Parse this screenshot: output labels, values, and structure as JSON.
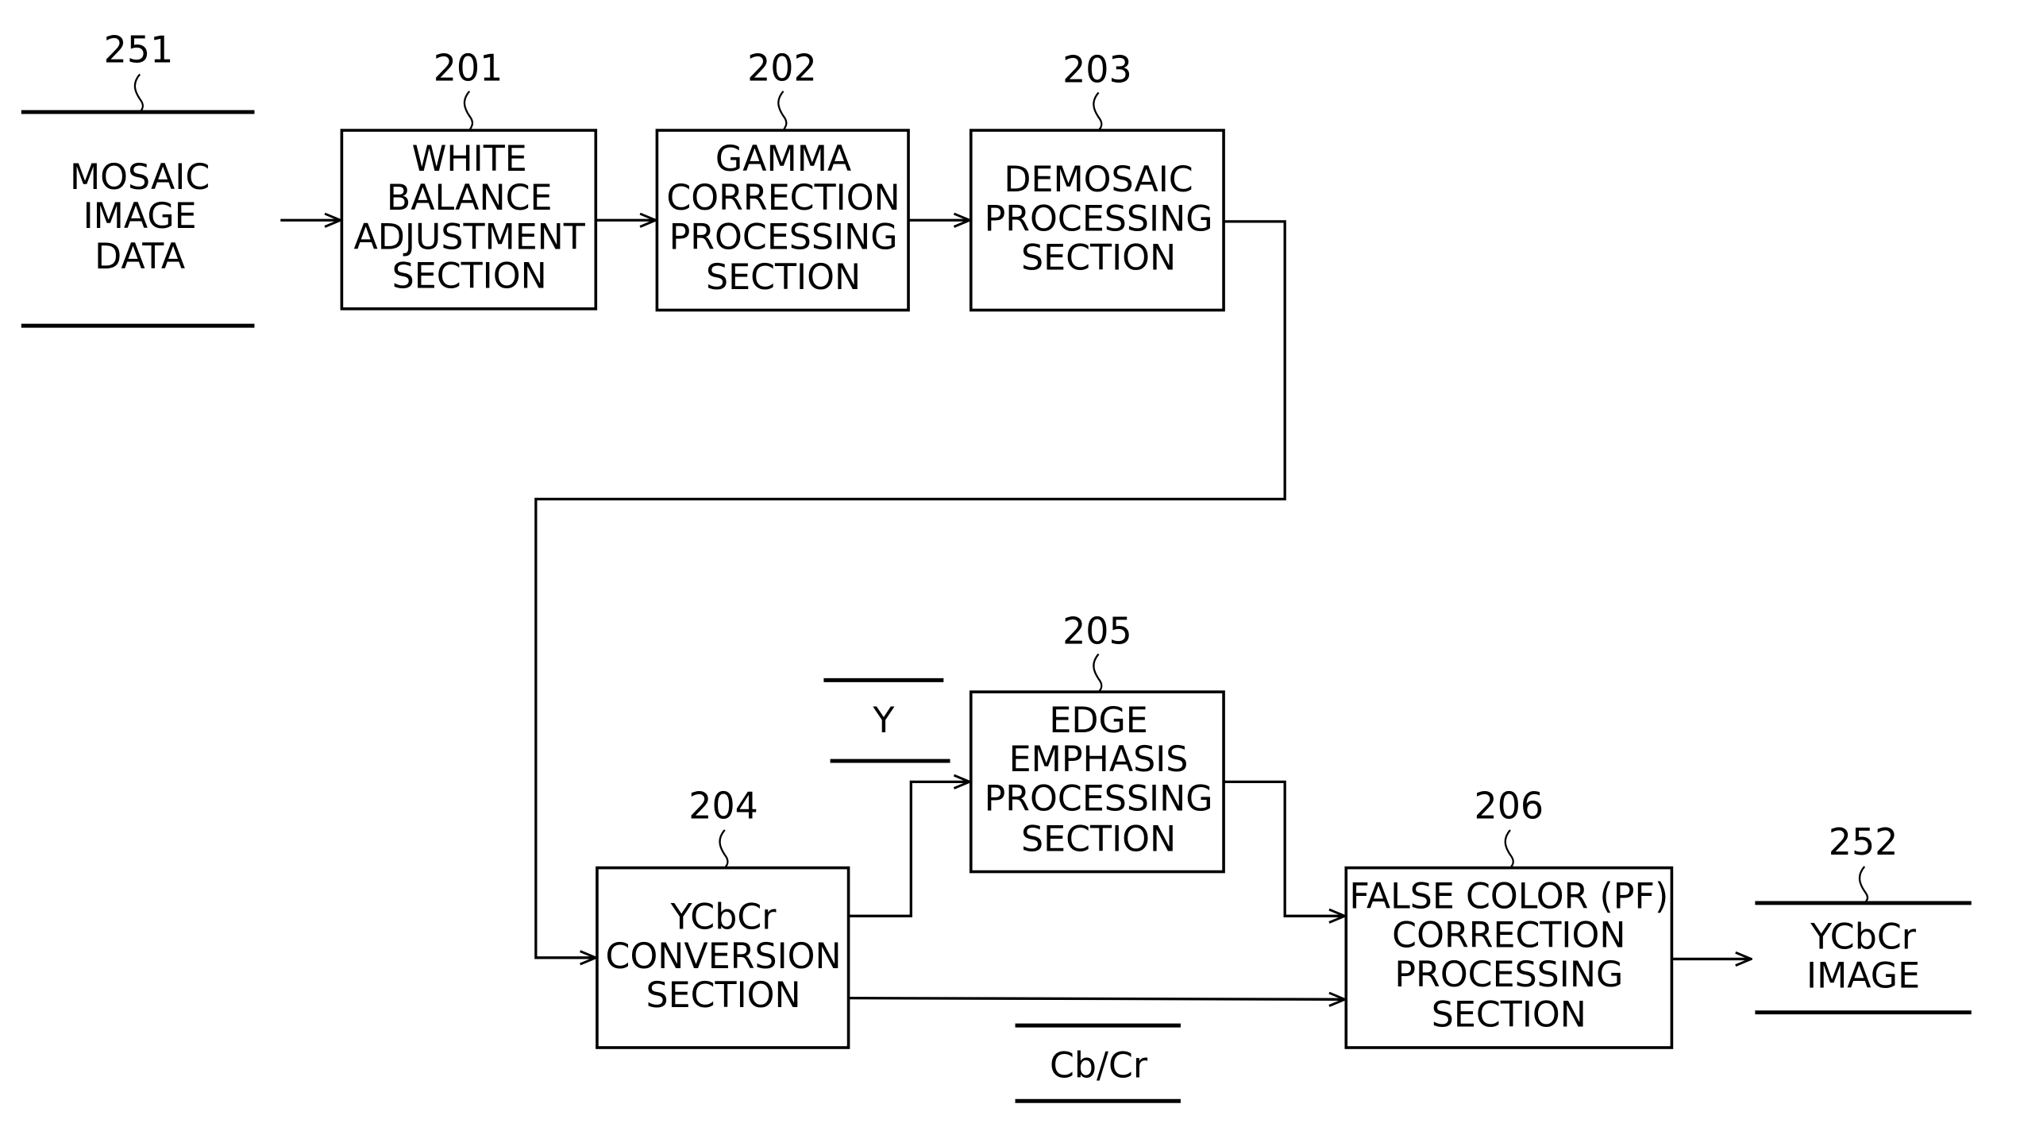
{
  "diagram": {
    "blocks": [
      {
        "id": "201",
        "ref": "201",
        "lines": [
          "WHITE",
          "BALANCE",
          "ADJUSTMENT",
          "SECTION"
        ]
      },
      {
        "id": "202",
        "ref": "202",
        "lines": [
          "GAMMA",
          "CORRECTION",
          "PROCESSING",
          "SECTION"
        ]
      },
      {
        "id": "203",
        "ref": "203",
        "lines": [
          "DEMOSAIC",
          "PROCESSING",
          "SECTION"
        ]
      },
      {
        "id": "204",
        "ref": "204",
        "lines": [
          "YCbCr",
          "CONVERSION",
          "SECTION"
        ]
      },
      {
        "id": "205",
        "ref": "205",
        "lines": [
          "EDGE",
          "EMPHASIS",
          "PROCESSING",
          "SECTION"
        ]
      },
      {
        "id": "206",
        "ref": "206",
        "lines": [
          "FALSE COLOR (PF)",
          "CORRECTION",
          "PROCESSING",
          "SECTION"
        ]
      }
    ],
    "data_stores": [
      {
        "id": "251",
        "ref": "251",
        "lines": [
          "MOSAIC",
          "IMAGE",
          "DATA"
        ]
      },
      {
        "id": "252",
        "ref": "252",
        "lines": [
          "YCbCr",
          "IMAGE"
        ]
      }
    ],
    "signals": {
      "y": "Y",
      "cbcr": "Cb/Cr"
    },
    "connections": [
      {
        "from": "251",
        "to": "201"
      },
      {
        "from": "201",
        "to": "202"
      },
      {
        "from": "202",
        "to": "203"
      },
      {
        "from": "203",
        "to": "204"
      },
      {
        "from": "204",
        "to": "205",
        "signal": "Y"
      },
      {
        "from": "204",
        "to": "206",
        "signal": "Cb/Cr"
      },
      {
        "from": "205",
        "to": "206"
      },
      {
        "from": "206",
        "to": "252"
      }
    ]
  }
}
